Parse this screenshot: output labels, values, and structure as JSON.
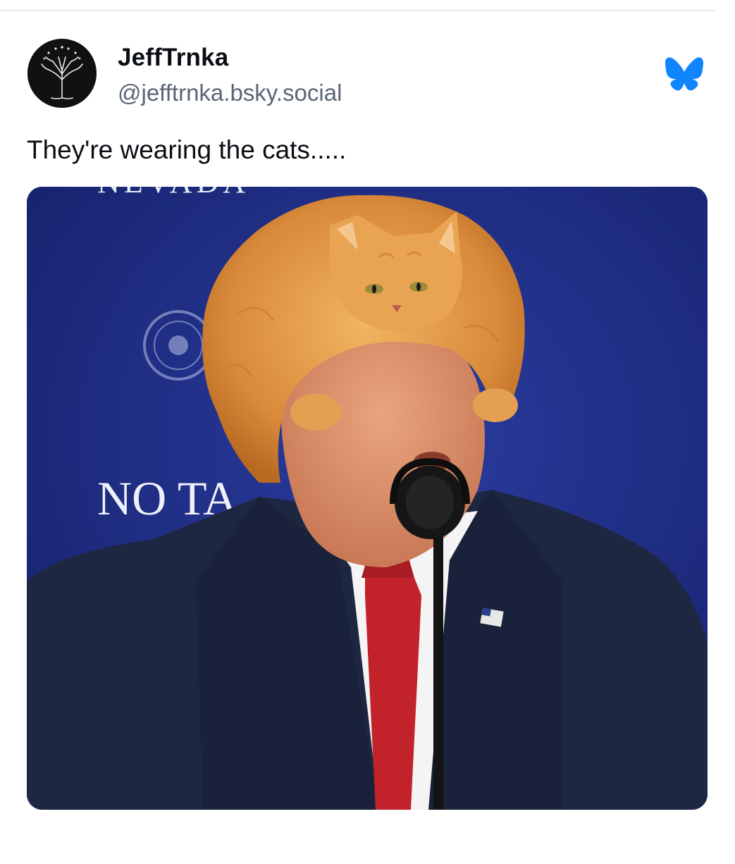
{
  "post": {
    "author": {
      "display_name": "JeffTrnka",
      "handle": "@jefftrnka.bsky.social",
      "avatar_icon": "white-tree-icon"
    },
    "platform_icon": "bluesky-butterfly-icon",
    "text": "They're wearing the cats.....",
    "media": {
      "sign_text_top": "NEVADA",
      "sign_text_bottom": "NO TA"
    }
  },
  "colors": {
    "brand": "#1185fe",
    "name": "#0b0f14",
    "secondary": "#5a6675",
    "backdrop": "#1b2a7d"
  }
}
